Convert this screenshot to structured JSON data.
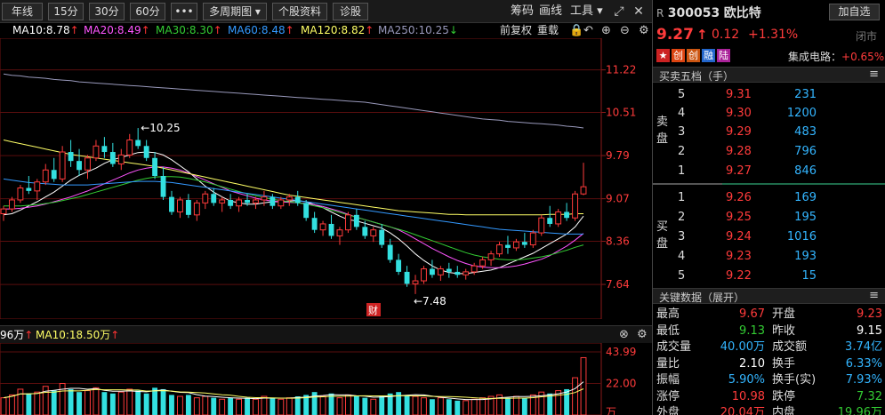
{
  "toolbar": {
    "buttons": [
      "年线",
      "15分",
      "30分",
      "60分",
      "•••",
      "多周期图 ▾",
      "个股资料",
      "诊股"
    ],
    "right_texts": [
      "筹码",
      "画线",
      "工具 ▾"
    ],
    "right_icons": [
      "⤢",
      "✕"
    ]
  },
  "ma_line": {
    "items": [
      {
        "label": "MA10:8.78",
        "arrow": "↑",
        "color": "#ffffff"
      },
      {
        "label": "MA20:8.49",
        "arrow": "↑",
        "color": "#ff55ff"
      },
      {
        "label": "MA30:8.30",
        "arrow": "↑",
        "color": "#33cc33"
      },
      {
        "label": "MA60:8.48",
        "arrow": "↑",
        "color": "#3399ff"
      },
      {
        "label": "MA120:8.82",
        "arrow": "↑",
        "color": "#ffff66"
      },
      {
        "label": "MA250:10.25",
        "arrow": "↓",
        "color": "#9999bb"
      }
    ],
    "controls": {
      "restore": "前复权",
      "overlay": "重载",
      "lock_icon": "🔒",
      "undo_icon": "↶",
      "zoom_in_icon": "⊕",
      "zoom_out_icon": "⊖",
      "settings_icon": "⚙"
    }
  },
  "chart_data": {
    "type": "candlestick",
    "y_ticks": [
      11.22,
      10.51,
      9.79,
      9.07,
      8.36,
      7.64
    ],
    "ylim": [
      7.3,
      11.6
    ],
    "annotations": [
      {
        "text": "←10.25"
      },
      {
        "text": "←7.48"
      }
    ],
    "marker": "财",
    "ohlc": [
      [
        8.82,
        8.95,
        8.7,
        8.9
      ],
      [
        8.9,
        9.1,
        8.85,
        9.05
      ],
      [
        9.05,
        9.3,
        9.0,
        9.25
      ],
      [
        9.25,
        9.45,
        9.15,
        9.2
      ],
      [
        9.2,
        9.4,
        9.05,
        9.35
      ],
      [
        9.35,
        9.65,
        9.3,
        9.55
      ],
      [
        9.55,
        9.75,
        9.35,
        9.4
      ],
      [
        9.4,
        9.95,
        9.35,
        9.85
      ],
      [
        9.85,
        10.05,
        9.6,
        9.7
      ],
      [
        9.7,
        9.9,
        9.45,
        9.55
      ],
      [
        9.55,
        9.8,
        9.4,
        9.75
      ],
      [
        9.75,
        10.05,
        9.7,
        9.95
      ],
      [
        9.95,
        10.1,
        9.75,
        9.85
      ],
      [
        9.85,
        10.0,
        9.6,
        9.65
      ],
      [
        9.65,
        9.9,
        9.55,
        9.8
      ],
      [
        9.8,
        10.15,
        9.75,
        10.05
      ],
      [
        10.05,
        10.25,
        9.9,
        9.95
      ],
      [
        9.95,
        10.05,
        9.7,
        9.75
      ],
      [
        9.75,
        9.85,
        9.4,
        9.45
      ],
      [
        9.45,
        9.6,
        9.05,
        9.1
      ],
      [
        9.1,
        9.2,
        8.8,
        8.85
      ],
      [
        8.85,
        9.1,
        8.75,
        9.05
      ],
      [
        9.05,
        9.15,
        8.75,
        8.8
      ],
      [
        8.8,
        9.05,
        8.7,
        9.0
      ],
      [
        9.0,
        9.2,
        8.9,
        9.15
      ],
      [
        9.15,
        9.25,
        8.95,
        9.0
      ],
      [
        9.0,
        9.1,
        8.85,
        9.05
      ],
      [
        9.05,
        9.15,
        8.9,
        8.95
      ],
      [
        8.95,
        9.1,
        8.85,
        9.05
      ],
      [
        9.05,
        9.15,
        8.95,
        9.0
      ],
      [
        9.0,
        9.1,
        8.9,
        9.05
      ],
      [
        9.05,
        9.2,
        8.95,
        9.1
      ],
      [
        9.1,
        9.15,
        8.9,
        8.95
      ],
      [
        8.95,
        9.1,
        8.9,
        9.05
      ],
      [
        9.05,
        9.15,
        8.95,
        9.1
      ],
      [
        9.1,
        9.2,
        8.95,
        9.0
      ],
      [
        9.0,
        9.05,
        8.7,
        8.75
      ],
      [
        8.75,
        8.85,
        8.5,
        8.55
      ],
      [
        8.55,
        8.7,
        8.45,
        8.65
      ],
      [
        8.65,
        8.8,
        8.4,
        8.45
      ],
      [
        8.45,
        8.6,
        8.3,
        8.55
      ],
      [
        8.55,
        8.85,
        8.5,
        8.8
      ],
      [
        8.8,
        8.9,
        8.55,
        8.6
      ],
      [
        8.6,
        8.7,
        8.4,
        8.45
      ],
      [
        8.45,
        8.6,
        8.35,
        8.55
      ],
      [
        8.55,
        8.65,
        8.25,
        8.3
      ],
      [
        8.3,
        8.4,
        8.0,
        8.05
      ],
      [
        8.05,
        8.15,
        7.8,
        7.85
      ],
      [
        7.85,
        7.95,
        7.6,
        7.65
      ],
      [
        7.65,
        7.8,
        7.48,
        7.7
      ],
      [
        7.7,
        7.95,
        7.65,
        7.9
      ],
      [
        7.9,
        8.05,
        7.75,
        7.8
      ],
      [
        7.8,
        7.95,
        7.7,
        7.9
      ],
      [
        7.9,
        8.0,
        7.75,
        7.85
      ],
      [
        7.85,
        7.95,
        7.75,
        7.8
      ],
      [
        7.8,
        7.9,
        7.72,
        7.85
      ],
      [
        7.85,
        8.0,
        7.8,
        7.95
      ],
      [
        7.95,
        8.1,
        7.9,
        8.05
      ],
      [
        8.05,
        8.2,
        7.95,
        8.15
      ],
      [
        8.15,
        8.35,
        8.1,
        8.3
      ],
      [
        8.3,
        8.45,
        8.15,
        8.25
      ],
      [
        8.25,
        8.4,
        8.2,
        8.35
      ],
      [
        8.35,
        8.5,
        8.25,
        8.3
      ],
      [
        8.3,
        8.55,
        8.25,
        8.5
      ],
      [
        8.5,
        8.8,
        8.45,
        8.75
      ],
      [
        8.75,
        8.95,
        8.6,
        8.65
      ],
      [
        8.65,
        8.9,
        8.6,
        8.85
      ],
      [
        8.85,
        9.0,
        8.7,
        8.75
      ],
      [
        8.75,
        9.2,
        8.7,
        9.15
      ],
      [
        9.15,
        9.67,
        9.13,
        9.27
      ]
    ],
    "volume_ticks": [
      "43.99",
      "22.00",
      "万"
    ],
    "volume": [
      12,
      14,
      18,
      15,
      16,
      20,
      17,
      22,
      18,
      16,
      17,
      19,
      16,
      15,
      16,
      18,
      17,
      15,
      19,
      18,
      14,
      13,
      14,
      12,
      13,
      12,
      11,
      12,
      11,
      12,
      11,
      13,
      12,
      11,
      12,
      13,
      14,
      16,
      13,
      15,
      12,
      14,
      13,
      12,
      11,
      13,
      15,
      16,
      14,
      13,
      12,
      11,
      12,
      11,
      10,
      10,
      11,
      12,
      13,
      14,
      12,
      13,
      12,
      14,
      16,
      15,
      17,
      18,
      26,
      40
    ],
    "ma_series": [
      {
        "name": "MA10",
        "color": "#ffffff",
        "values": [
          8.8,
          8.82,
          8.88,
          8.95,
          9.02,
          9.1,
          9.18,
          9.28,
          9.38,
          9.46,
          9.52,
          9.58,
          9.66,
          9.72,
          9.76,
          9.8,
          9.84,
          9.85,
          9.84,
          9.8,
          9.72,
          9.62,
          9.52,
          9.4,
          9.28,
          9.18,
          9.1,
          9.03,
          9.0,
          8.98,
          8.98,
          9.0,
          9.02,
          9.02,
          9.03,
          9.04,
          9.02,
          8.97,
          8.92,
          8.85,
          8.78,
          8.72,
          8.7,
          8.66,
          8.62,
          8.58,
          8.5,
          8.4,
          8.28,
          8.15,
          8.04,
          7.95,
          7.88,
          7.84,
          7.82,
          7.82,
          7.84,
          7.86,
          7.88,
          7.92,
          7.98,
          8.04,
          8.1,
          8.16,
          8.24,
          8.32,
          8.4,
          8.48,
          8.6,
          8.78
        ]
      },
      {
        "name": "MA20",
        "color": "#ff55ff",
        "values": [
          8.9,
          8.9,
          8.91,
          8.93,
          8.95,
          8.98,
          9.02,
          9.06,
          9.1,
          9.15,
          9.2,
          9.26,
          9.32,
          9.38,
          9.44,
          9.5,
          9.55,
          9.58,
          9.6,
          9.6,
          9.58,
          9.55,
          9.5,
          9.44,
          9.38,
          9.32,
          9.26,
          9.2,
          9.16,
          9.12,
          9.08,
          9.05,
          9.03,
          9.02,
          9.01,
          9.0,
          8.99,
          8.97,
          8.94,
          8.9,
          8.86,
          8.81,
          8.76,
          8.72,
          8.68,
          8.64,
          8.6,
          8.55,
          8.48,
          8.4,
          8.32,
          8.24,
          8.17,
          8.1,
          8.04,
          7.99,
          7.95,
          7.93,
          7.92,
          7.92,
          7.93,
          7.95,
          7.98,
          8.02,
          8.06,
          8.12,
          8.2,
          8.28,
          8.38,
          8.49
        ]
      },
      {
        "name": "MA30",
        "color": "#33cc33",
        "values": [
          8.95,
          8.95,
          8.95,
          8.96,
          8.97,
          8.99,
          9.01,
          9.04,
          9.07,
          9.1,
          9.14,
          9.18,
          9.22,
          9.26,
          9.3,
          9.34,
          9.38,
          9.41,
          9.43,
          9.44,
          9.44,
          9.43,
          9.41,
          9.38,
          9.35,
          9.31,
          9.27,
          9.23,
          9.19,
          9.15,
          9.12,
          9.09,
          9.06,
          9.04,
          9.02,
          9.0,
          8.98,
          8.95,
          8.92,
          8.88,
          8.84,
          8.8,
          8.76,
          8.72,
          8.68,
          8.64,
          8.6,
          8.56,
          8.52,
          8.47,
          8.42,
          8.37,
          8.32,
          8.27,
          8.22,
          8.17,
          8.13,
          8.1,
          8.08,
          8.06,
          8.05,
          8.05,
          8.06,
          8.08,
          8.1,
          8.13,
          8.17,
          8.21,
          8.26,
          8.3
        ]
      },
      {
        "name": "MA60",
        "color": "#3399ff",
        "values": [
          9.4,
          9.38,
          9.36,
          9.34,
          9.33,
          9.32,
          9.31,
          9.3,
          9.3,
          9.3,
          9.3,
          9.31,
          9.32,
          9.33,
          9.34,
          9.35,
          9.36,
          9.36,
          9.36,
          9.35,
          9.34,
          9.32,
          9.3,
          9.28,
          9.26,
          9.24,
          9.22,
          9.2,
          9.18,
          9.16,
          9.14,
          9.12,
          9.1,
          9.08,
          9.06,
          9.04,
          9.02,
          9.0,
          8.98,
          8.96,
          8.94,
          8.92,
          8.9,
          8.88,
          8.86,
          8.84,
          8.82,
          8.8,
          8.78,
          8.76,
          8.74,
          8.72,
          8.7,
          8.68,
          8.66,
          8.64,
          8.62,
          8.6,
          8.58,
          8.56,
          8.55,
          8.54,
          8.53,
          8.52,
          8.51,
          8.5,
          8.49,
          8.48,
          8.48,
          8.48
        ]
      },
      {
        "name": "MA120",
        "color": "#ffff66",
        "values": [
          10.05,
          10.02,
          9.99,
          9.96,
          9.93,
          9.9,
          9.87,
          9.84,
          9.81,
          9.79,
          9.77,
          9.75,
          9.73,
          9.71,
          9.69,
          9.67,
          9.65,
          9.63,
          9.61,
          9.58,
          9.55,
          9.52,
          9.49,
          9.46,
          9.43,
          9.4,
          9.37,
          9.34,
          9.31,
          9.28,
          9.25,
          9.22,
          9.19,
          9.16,
          9.13,
          9.11,
          9.09,
          9.07,
          9.05,
          9.03,
          9.01,
          8.99,
          8.97,
          8.95,
          8.93,
          8.91,
          8.89,
          8.87,
          8.86,
          8.85,
          8.84,
          8.83,
          8.82,
          8.81,
          8.81,
          8.8,
          8.8,
          8.8,
          8.8,
          8.8,
          8.8,
          8.8,
          8.8,
          8.8,
          8.8,
          8.81,
          8.81,
          8.81,
          8.82,
          8.82
        ]
      },
      {
        "name": "MA250",
        "color": "#9999bb",
        "values": [
          11.15,
          11.13,
          11.12,
          11.1,
          11.09,
          11.08,
          11.06,
          11.05,
          11.04,
          11.02,
          11.01,
          11.0,
          10.99,
          10.98,
          10.97,
          10.96,
          10.95,
          10.94,
          10.93,
          10.92,
          10.91,
          10.9,
          10.89,
          10.88,
          10.87,
          10.86,
          10.85,
          10.84,
          10.83,
          10.82,
          10.81,
          10.8,
          10.79,
          10.78,
          10.77,
          10.76,
          10.75,
          10.74,
          10.73,
          10.72,
          10.71,
          10.7,
          10.69,
          10.68,
          10.66,
          10.64,
          10.62,
          10.6,
          10.58,
          10.56,
          10.54,
          10.52,
          10.5,
          10.48,
          10.46,
          10.44,
          10.42,
          10.4,
          10.39,
          10.38,
          10.36,
          10.35,
          10.34,
          10.33,
          10.32,
          10.31,
          10.3,
          10.28,
          10.27,
          10.25
        ]
      }
    ]
  },
  "volume_bar": {
    "items": [
      {
        "label": "96万",
        "arrow": "↑",
        "color": "#ffffff"
      },
      {
        "label": "MA10:18.50万",
        "arrow": "↑",
        "color": "#ffff66"
      }
    ],
    "close_icon": "⊗",
    "settings_icon": "⚙"
  },
  "stock": {
    "prefix": "R",
    "code": "300053",
    "name": "欧比特",
    "price": "9.27",
    "arrow": "↑",
    "change": "0.12",
    "change_pct": "+1.31%",
    "add_watch": "加自选",
    "status": "闭市",
    "tags": [
      {
        "text": "★",
        "color": "#cc2222"
      },
      {
        "text": "创",
        "color": "#dd4411"
      },
      {
        "text": "创",
        "color": "#cc5511"
      },
      {
        "text": "融",
        "color": "#2266cc"
      },
      {
        "text": "陆",
        "color": "#aa2299"
      }
    ],
    "sector_label": "集成电路：",
    "sector_change": "+0.65%"
  },
  "orderbook": {
    "title": "买卖五档（手）",
    "menu_icon": "≡",
    "sell_label": "卖盘",
    "buy_label": "买盘",
    "asks": [
      {
        "level": "5",
        "price": "9.31",
        "volume": "231"
      },
      {
        "level": "4",
        "price": "9.30",
        "volume": "1200"
      },
      {
        "level": "3",
        "price": "9.29",
        "volume": "483"
      },
      {
        "level": "2",
        "price": "9.28",
        "volume": "796"
      },
      {
        "level": "1",
        "price": "9.27",
        "volume": "846"
      }
    ],
    "bids": [
      {
        "level": "1",
        "price": "9.26",
        "volume": "169"
      },
      {
        "level": "2",
        "price": "9.25",
        "volume": "195"
      },
      {
        "level": "3",
        "price": "9.24",
        "volume": "1016"
      },
      {
        "level": "4",
        "price": "9.23",
        "volume": "193"
      },
      {
        "level": "5",
        "price": "9.22",
        "volume": "15"
      }
    ]
  },
  "key_data": {
    "title": "关键数据（展开）",
    "menu_icon": "≡",
    "rows": [
      [
        {
          "label": "最高",
          "value": "9.67",
          "color": "#ff3b3b"
        },
        {
          "label": "开盘",
          "value": "9.23",
          "color": "#ff3b3b"
        }
      ],
      [
        {
          "label": "最低",
          "value": "9.13",
          "color": "#33cc33"
        },
        {
          "label": "昨收",
          "value": "9.15",
          "color": "#ffffff"
        }
      ],
      [
        {
          "label": "成交量",
          "value": "40.00万",
          "color": "#33b5ff"
        },
        {
          "label": "成交额",
          "value": "3.74亿",
          "color": "#33b5ff"
        }
      ],
      [
        {
          "label": "量比",
          "value": "2.10",
          "color": "#ffffff"
        },
        {
          "label": "换手",
          "value": "6.33%",
          "color": "#33b5ff"
        }
      ],
      [
        {
          "label": "振幅",
          "value": "5.90%",
          "color": "#33b5ff"
        },
        {
          "label": "换手(实)",
          "value": "7.93%",
          "color": "#33b5ff"
        }
      ],
      [
        {
          "label": "涨停",
          "value": "10.98",
          "color": "#ff3b3b"
        },
        {
          "label": "跌停",
          "value": "7.32",
          "color": "#33cc33"
        }
      ],
      [
        {
          "label": "外盘",
          "value": "20.04万",
          "color": "#ff3b3b"
        },
        {
          "label": "内盘",
          "value": "19.96万",
          "color": "#33cc33"
        }
      ]
    ]
  }
}
